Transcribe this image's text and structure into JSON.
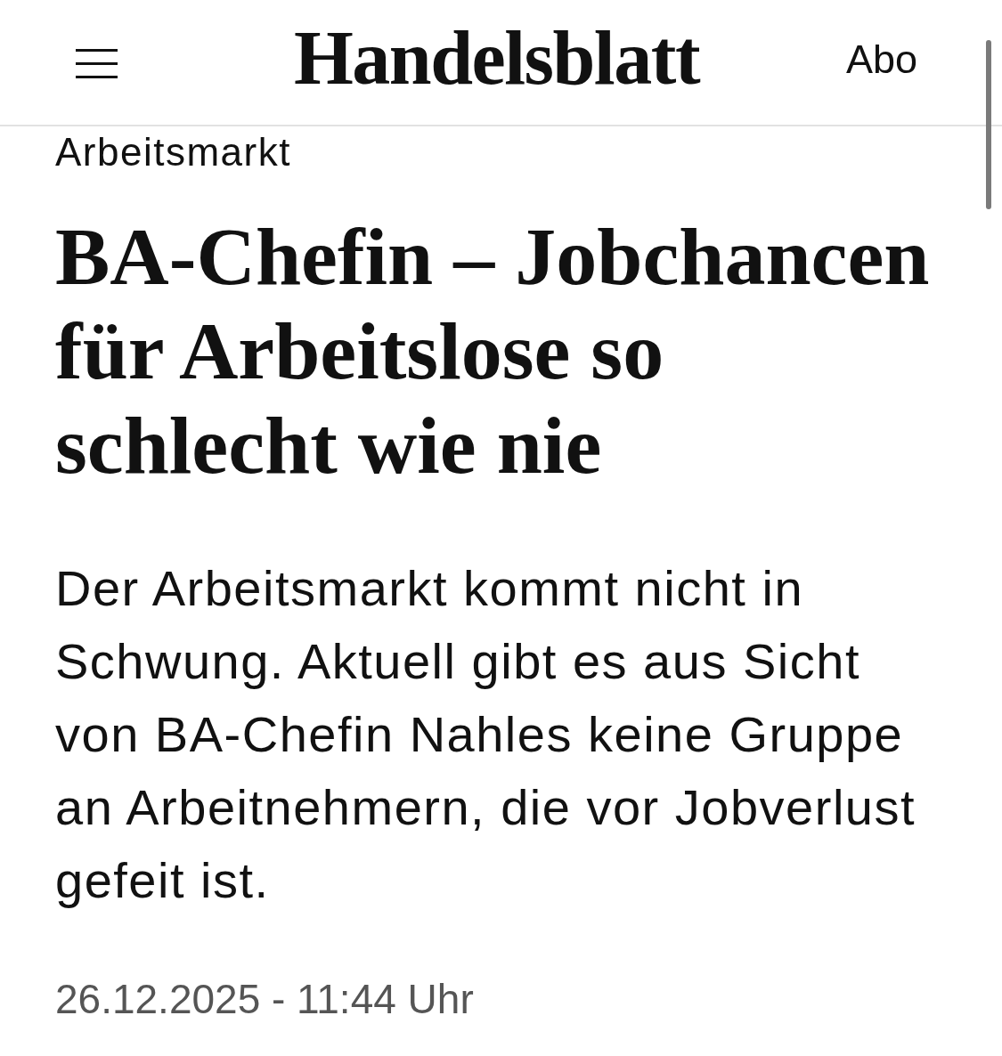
{
  "header": {
    "logo": "Handelsblatt",
    "subscribe": "Abo"
  },
  "article": {
    "kicker": "Arbeitsmarkt",
    "headline": "BA-Chefin – Jobchancen für Arbeitslose so schlecht wie nie",
    "lead": "Der Arbeitsmarkt kommt nicht in Schwung. Aktuell gibt es aus Sicht von BA-Chefin Nahles keine Gruppe an Arbeitnehmern, die vor Jobverlust gefeit ist.",
    "published": "26.12.2025 - 11:44 Uhr"
  }
}
